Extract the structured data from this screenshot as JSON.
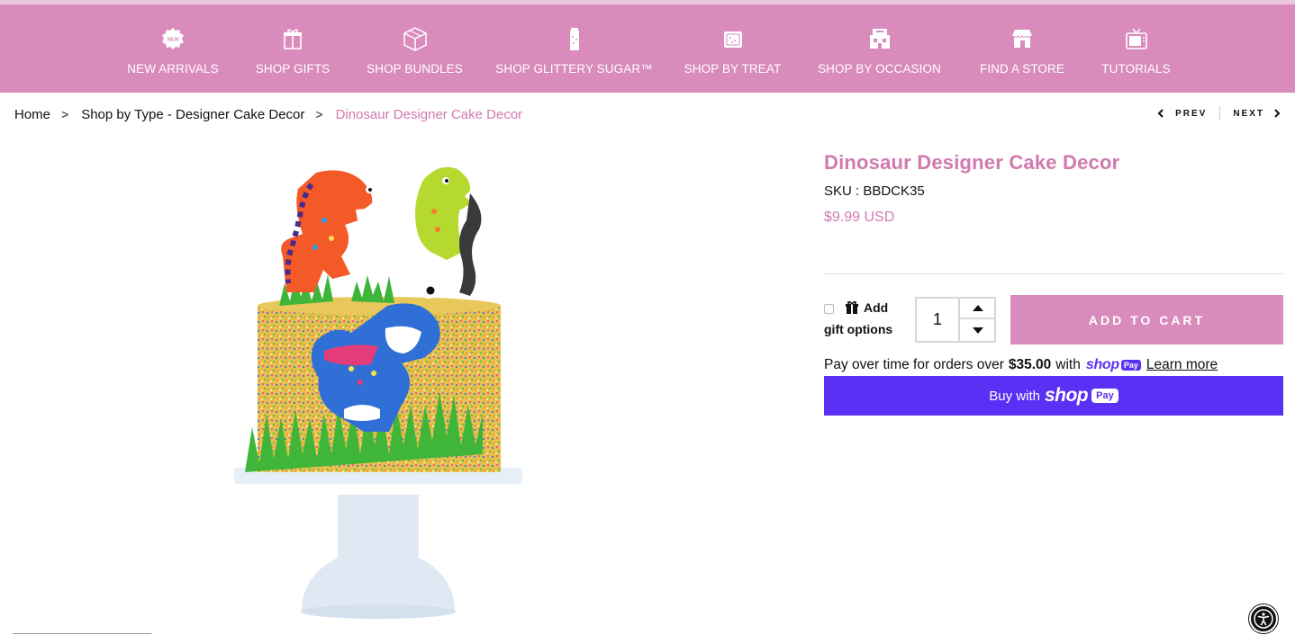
{
  "nav": {
    "items": [
      {
        "label": "NEW ARRIVALS",
        "icon": "new-badge-icon"
      },
      {
        "label": "SHOP GIFTS",
        "icon": "gift-box-icon"
      },
      {
        "label": "SHOP BUNDLES",
        "icon": "bundle-box-icon"
      },
      {
        "label": "SHOP GLITTERY SUGAR™",
        "icon": "sugar-jar-icon"
      },
      {
        "label": "SHOP BY TREAT",
        "icon": "treat-cookie-icon"
      },
      {
        "label": "SHOP BY OCCASION",
        "icon": "occasion-cake-icon"
      },
      {
        "label": "FIND A STORE",
        "icon": "store-icon"
      },
      {
        "label": "TUTORIALS",
        "icon": "tv-icon"
      }
    ],
    "new_badge_text": "NEW"
  },
  "breadcrumb": {
    "home": "Home",
    "category": "Shop by Type - Designer Cake Decor",
    "current": "Dinosaur Designer Cake Decor",
    "separator": ">"
  },
  "pager": {
    "prev": "PREV",
    "next": "NEXT"
  },
  "product": {
    "title": "Dinosaur Designer Cake Decor",
    "sku": "SKU : BBDCK35",
    "price": "$9.99 USD",
    "image_icon": "dinosaur-cake-image"
  },
  "gift": {
    "line1": "Add",
    "line2": "gift options"
  },
  "quantity": {
    "value": "1"
  },
  "add_to_cart": "ADD TO CART",
  "installments": {
    "text": "Pay over time for orders over",
    "amount": "$35.00",
    "with": "with",
    "shop_word": "shop",
    "pay_badge": "Pay",
    "learn_more": "Learn more"
  },
  "buy_button": {
    "text": "Buy with",
    "shop_word": "shop",
    "pay_badge": "Pay"
  },
  "colors": {
    "brand_pink": "#d98bbb",
    "title_pink": "#d179af",
    "shop_purple": "#5a31f4"
  }
}
